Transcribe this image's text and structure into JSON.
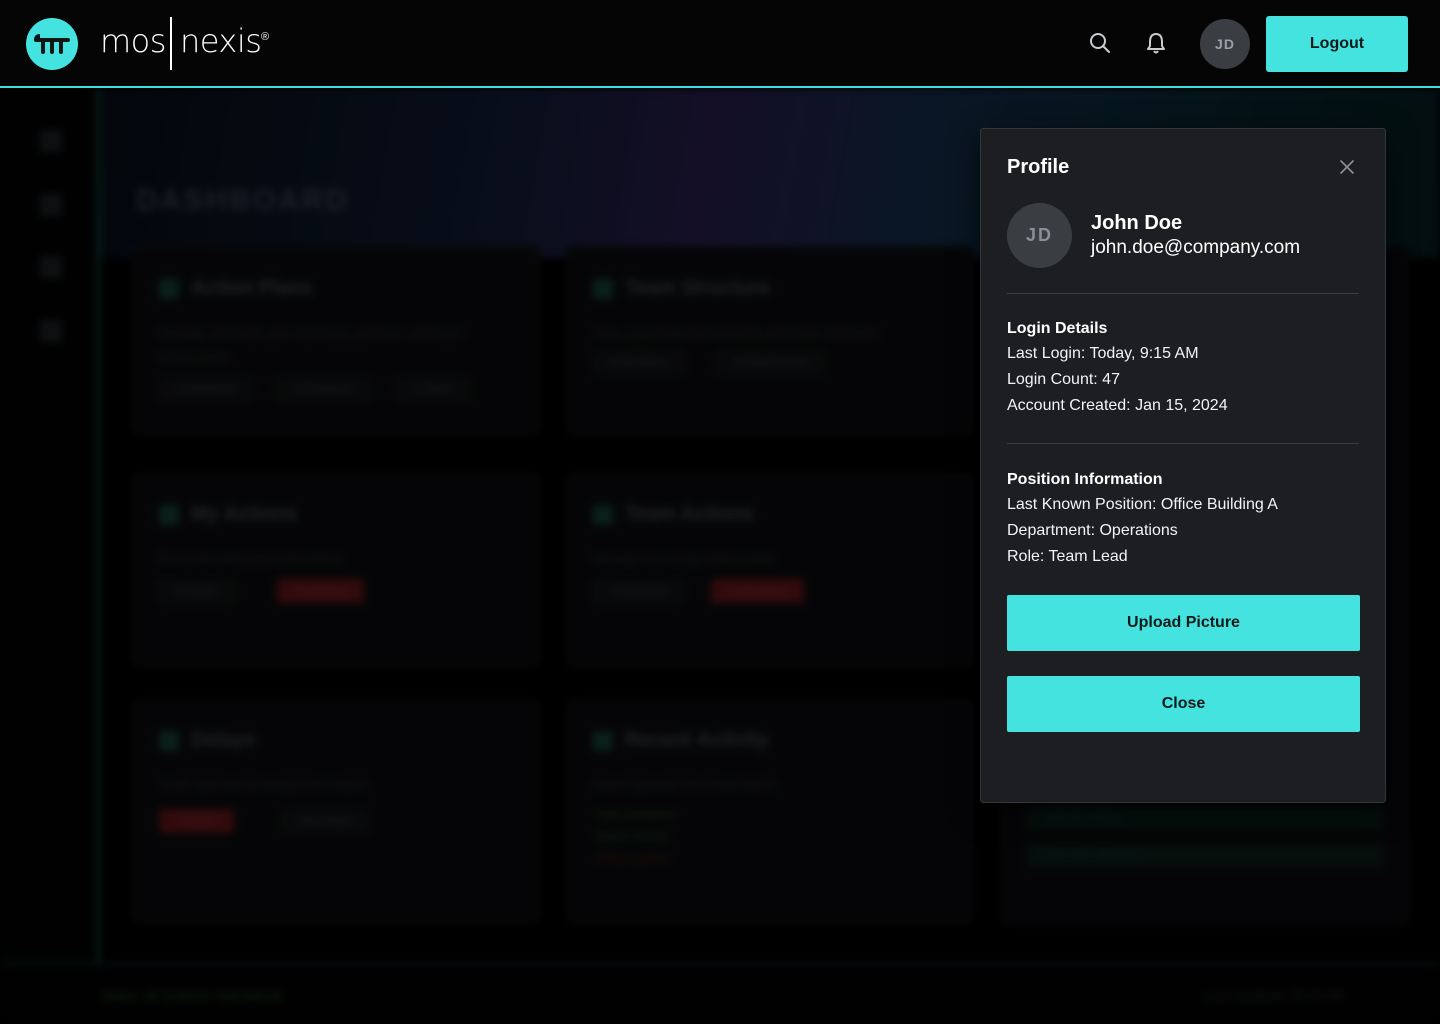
{
  "brand": {
    "left": "mos",
    "right": "nexis",
    "reg": "®"
  },
  "header": {
    "avatar_initials": "JD",
    "logout_label": "Logout"
  },
  "background": {
    "title": "DASHBOARD",
    "cards": [
      {
        "title": "Action Plans",
        "desc": "Manage and track your individual, position, and team action plans",
        "chips": [
          "3 Individual",
          "3 Positional",
          "1 Team"
        ]
      },
      {
        "title": "Team Structure",
        "desc": "View organizational hierarchy and team members",
        "chips": [
          "8 Members",
          "3 Departments"
        ]
      },
      {
        "title": "My Actions",
        "desc": "Personal tasks and action items",
        "chips": [
          "5 Active",
          "2 Overdue"
        ]
      },
      {
        "title": "Team Actions",
        "desc": "Manage and assign team tasks",
        "chips": [
          "4 Assigned",
          "1 Escalated"
        ]
      },
      {
        "title": "Delays",
        "desc": "Track operational delays and impact",
        "chips": [
          "2 Active",
          "View Stats"
        ]
      },
      {
        "title": "Recent Activity",
        "desc": "Latest updates and notifications",
        "activity": [
          "Task completed",
          "Report shared",
          "Delay reported"
        ]
      }
    ],
    "side_actions": [
      "Add KPI Widget",
      "Add Team Member"
    ],
    "footer_left": "Status: All Systems Operational",
    "footer_right": "Last Updated: 09:15 AM"
  },
  "profile": {
    "title": "Profile",
    "avatar_initials": "JD",
    "name": "John Doe",
    "email": "john.doe@company.com",
    "login_details": {
      "heading": "Login Details",
      "last_login": "Last Login: Today, 9:15 AM",
      "login_count": "Login Count: 47",
      "account_created": "Account Created: Jan 15, 2024"
    },
    "position_info": {
      "heading": "Position Information",
      "last_known": "Last Known Position: Office Building A",
      "department": "Department: Operations",
      "role": "Role: Team Lead"
    },
    "upload_label": "Upload Picture",
    "close_label": "Close"
  },
  "colors": {
    "accent": "#45e3df",
    "panel_bg": "#1c1e21",
    "header_bg": "#050505"
  },
  "icons": [
    "logo-icon",
    "search-icon",
    "bell-icon",
    "close-icon"
  ]
}
